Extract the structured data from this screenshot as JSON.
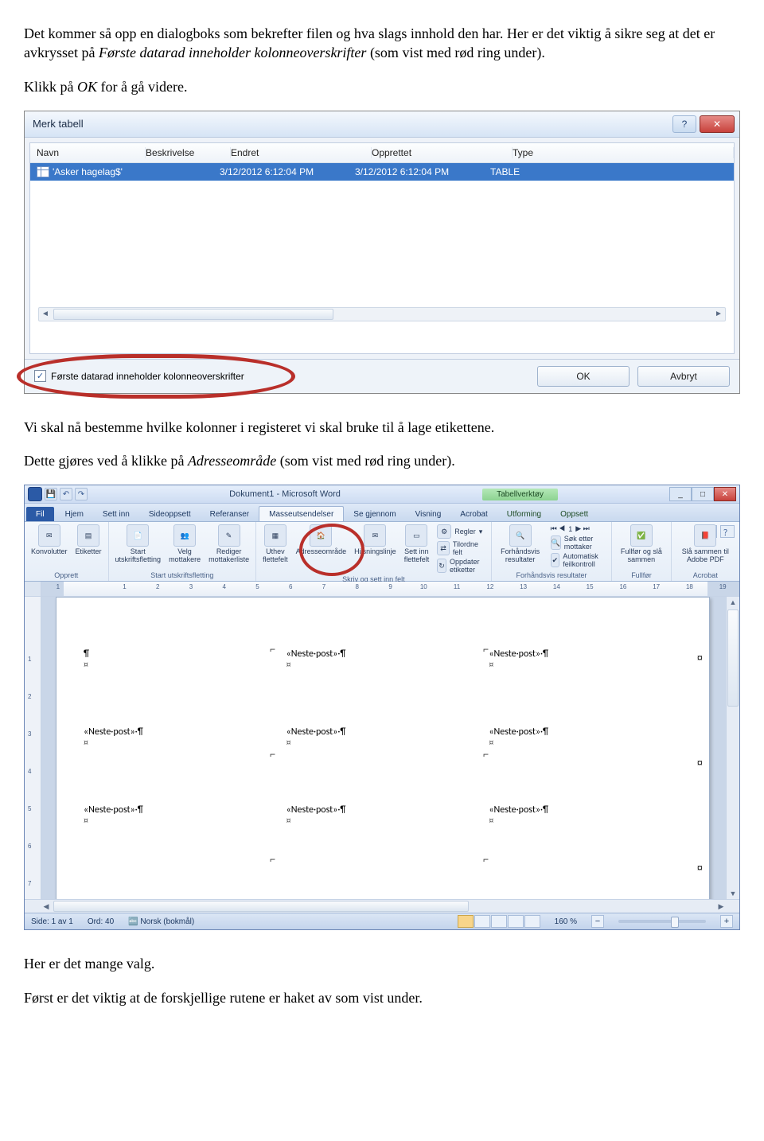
{
  "paragraphs": {
    "p1a": "Det kommer så opp en dialogboks som bekrefter filen og hva slags innhold den har. Her er det viktig å sikre seg at det er avkrysset på ",
    "p1i": "Første datarad inneholder kolonneoverskrifter",
    "p1b": " (som vist med rød ring under).",
    "p2a": "Klikk på ",
    "p2i": "OK",
    "p2b": " for å gå videre.",
    "p3": "Vi skal nå bestemme hvilke kolonner i registeret vi skal bruke til å lage etikettene.",
    "p4a": "Dette gjøres ved å klikke på ",
    "p4i": "Adresseområde",
    "p4b": " (som vist med rød ring under).",
    "p5": "Her er det mange valg.",
    "p6": "Først er det viktig at de forskjellige rutene er haket av som vist under."
  },
  "dialog": {
    "title": "Merk tabell",
    "headers": {
      "navn": "Navn",
      "besk": "Beskrivelse",
      "endret": "Endret",
      "opprettet": "Opprettet",
      "type": "Type"
    },
    "row": {
      "navn": "'Asker hagelag$'",
      "endret": "3/12/2012 6:12:04 PM",
      "opprettet": "3/12/2012 6:12:04 PM",
      "type": "TABLE"
    },
    "checkbox_label": "Første datarad inneholder kolonneoverskrifter",
    "ok": "OK",
    "cancel": "Avbryt",
    "help_symbol": "?",
    "close_symbol": "✕",
    "check_symbol": "✓"
  },
  "word": {
    "title": "Dokument1 - Microsoft Word",
    "tooltab": "Tabellverktøy",
    "qat": {
      "save": "💾",
      "undo": "↶",
      "redo": "↷"
    },
    "tabs": [
      "Fil",
      "Hjem",
      "Sett inn",
      "Sideoppsett",
      "Referanser",
      "Masseutsendelser",
      "Se gjennom",
      "Visning",
      "Acrobat",
      "Utforming",
      "Oppsett"
    ],
    "active_tab_index": 5,
    "ribbon": {
      "g_opprett": {
        "label": "Opprett",
        "items": [
          "Konvolutter",
          "Etiketter"
        ]
      },
      "g_start": {
        "label": "Start utskriftsfletting",
        "items": [
          "Start utskriftsfletting",
          "Velg mottakere",
          "Rediger mottakerliste"
        ]
      },
      "g_skriv": {
        "label": "Skriv og sett inn felt",
        "big": [
          "Uthev flettefelt",
          "Adresseområde",
          "Hilsningslinje",
          "Sett inn flettefelt"
        ],
        "mini": [
          "Regler",
          "Tilordne felt",
          "Oppdater etiketter"
        ]
      },
      "g_forh": {
        "label": "Forhåndsvis resultater",
        "big": "Forhåndsvis resultater",
        "mini": [
          "Søk etter mottaker",
          "Automatisk feilkontroll"
        ],
        "nav": "1"
      },
      "g_full": {
        "label": "Fullfør",
        "item": "Fullfør og slå sammen"
      },
      "g_acro": {
        "label": "Acrobat",
        "item": "Slå sammen til Adobe PDF"
      }
    },
    "ruler_numbers": [
      "1",
      "",
      "1",
      "2",
      "3",
      "4",
      "5",
      "6",
      "7",
      "8",
      "9",
      "10",
      "11",
      "12",
      "13",
      "14",
      "15",
      "16",
      "17",
      "18",
      "19"
    ],
    "vruler_numbers": [
      "",
      "1",
      "2",
      "3",
      "4",
      "5",
      "6",
      "7"
    ],
    "label_text": "«Neste·post»·¶",
    "label_mark": "¤",
    "first_cell_pilcrow": "¶",
    "row_end_mark": "¤",
    "status": {
      "page": "Side: 1 av 1",
      "words": "Ord: 40",
      "lang": "Norsk (bokmål)",
      "zoom": "160 %"
    },
    "zoom_thumb_pct": 60,
    "winbtns": {
      "min": "_",
      "max": "□",
      "close": "✕"
    },
    "help": {
      "caret": "˄",
      "q": "？"
    }
  }
}
